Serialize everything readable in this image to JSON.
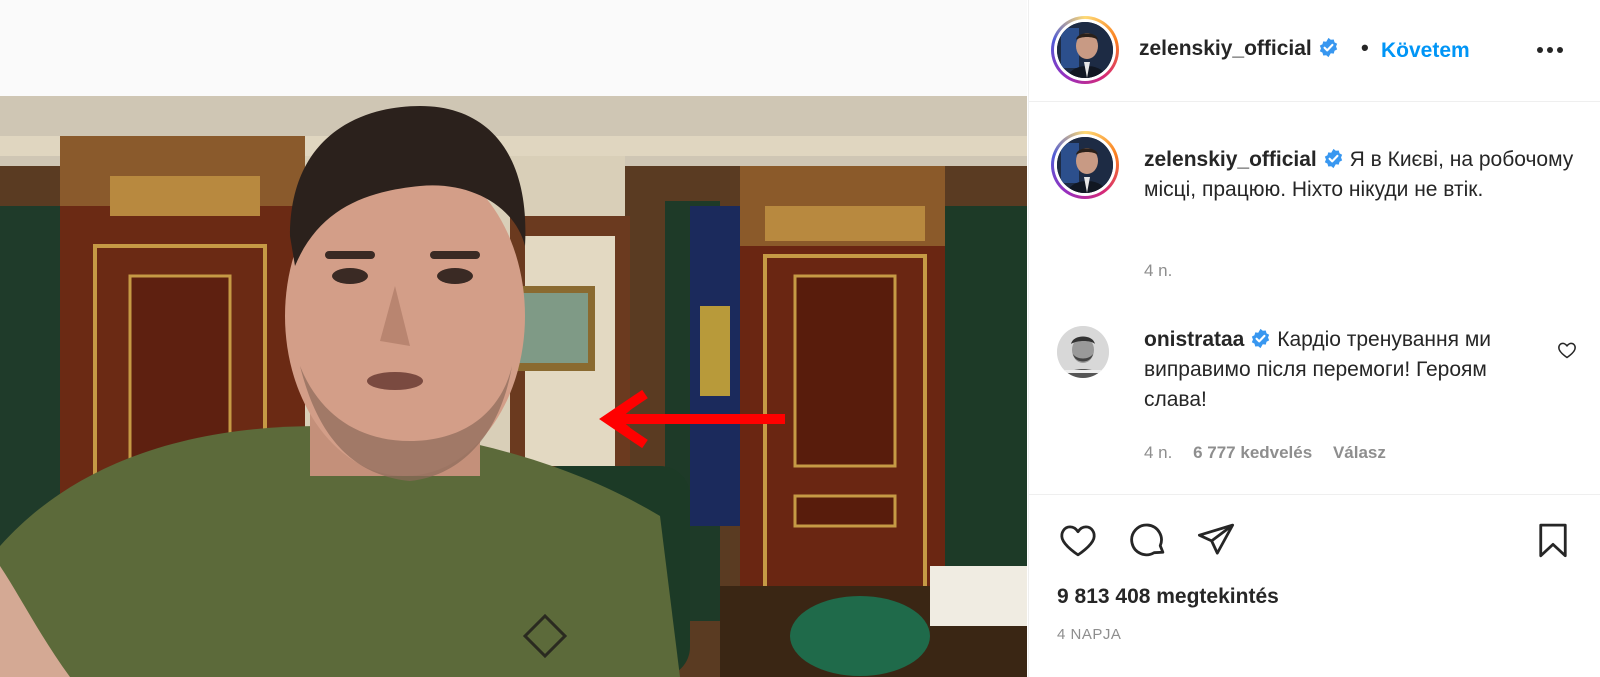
{
  "post": {
    "author": {
      "username": "zelenskiy_official",
      "verified": true,
      "follow_label": "Követem",
      "separator": "•"
    },
    "caption": {
      "text": "Я в Києві, на робочому місці, працюю. Ніхто нікуди не втік.",
      "time": "4 n."
    },
    "comments": [
      {
        "username": "onistrataa",
        "verified": true,
        "text": "Кардіо тренування ми виправимо після перемоги! Героям слава!",
        "time": "4 n.",
        "likes": "6 777 kedvelés",
        "reply_label": "Válasz"
      }
    ],
    "views": "9 813 408 megtekintés",
    "date": "4 NAPJA"
  },
  "icons": {
    "more": "more-options-icon",
    "like": "heart-icon",
    "comment": "comment-bubble-icon",
    "share": "paper-plane-icon",
    "save": "bookmark-icon",
    "verified": "verified-badge-icon",
    "annotation": "red-arrow-left"
  },
  "colors": {
    "link": "#0095f6",
    "verified": "#3897f0",
    "secondary_text": "#8e8e8e",
    "annotation_arrow": "#ff0000"
  }
}
